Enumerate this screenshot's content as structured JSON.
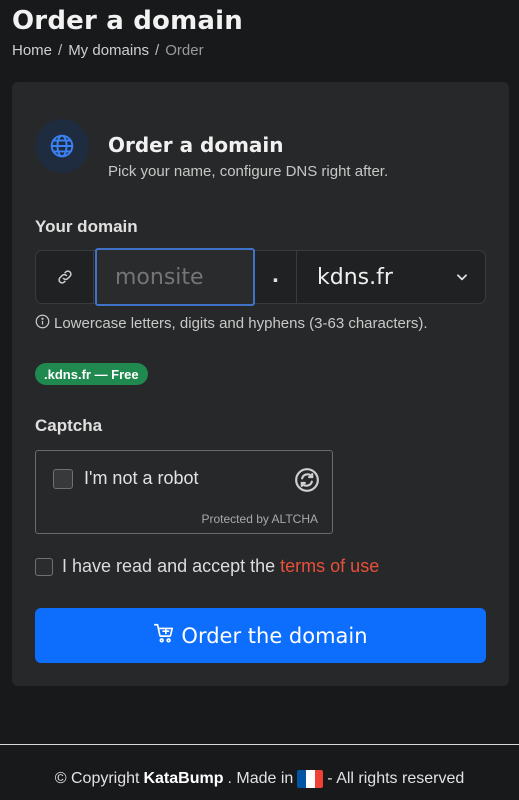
{
  "page": {
    "title": "Order a domain",
    "breadcrumb": [
      "Home",
      "My domains",
      "Order"
    ],
    "breadcrumb_sep": "/"
  },
  "card": {
    "title": "Order a domain",
    "subtitle": "Pick your name, configure DNS right after.",
    "header_icon": "globe-icon",
    "domain_label": "Your domain",
    "name_input": {
      "value": "",
      "placeholder": "monsite"
    },
    "dot": ".",
    "tld": {
      "selected": "kdns.fr"
    },
    "hint": "Lowercase letters, digits and hyphens (3-63 characters).",
    "badge": ".kdns.fr — Free",
    "captcha_label": "Captcha",
    "captcha": {
      "checkbox_label": "I'm not a robot",
      "footer": "Protected by ALTCHA"
    },
    "terms": {
      "prefix": "I have read and accept the",
      "link": "terms of use"
    },
    "order_button": "Order the domain"
  },
  "footer": {
    "copyright": "© Copyright",
    "brand": "KataBump",
    "made_in": ". Made in",
    "rights": "- All rights reserved"
  },
  "colors": {
    "accent": "#0d6efd",
    "badge": "#20894f",
    "link": "#e8503a",
    "flag": [
      "#0055a4",
      "#ffffff",
      "#ef4135"
    ]
  }
}
